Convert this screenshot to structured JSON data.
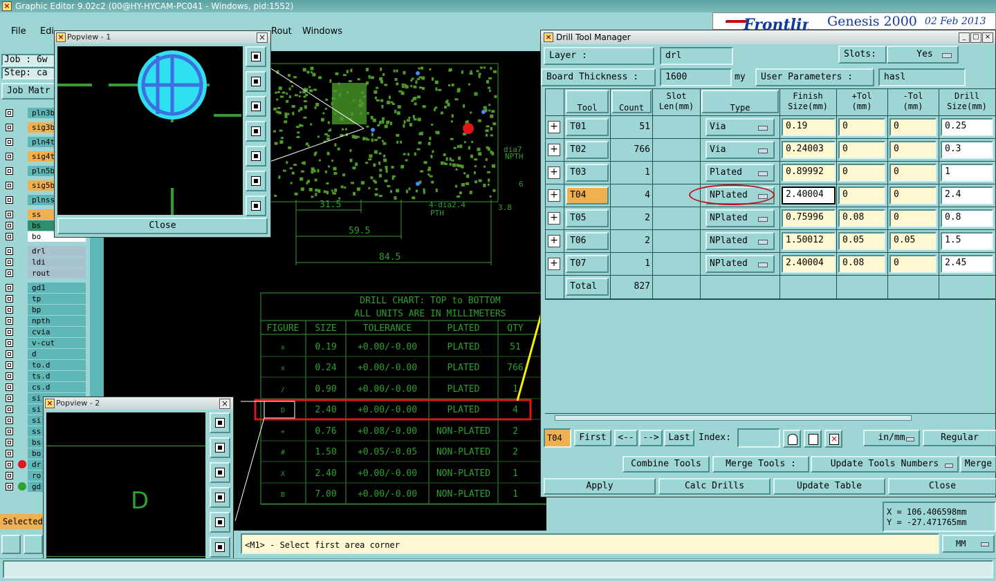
{
  "app": {
    "title": "Graphic Editor 9.02c2 (00@HY-HYCAM-PC041 - Windows, pid:1552)",
    "logo": "x-logo-icon"
  },
  "menu": {
    "items": [
      "File",
      "Edi",
      "Rout",
      "Windows"
    ]
  },
  "banner": {
    "brand": "Genesis 2000",
    "date": "02 Feb 2013"
  },
  "left": {
    "job_label": "Job : 6w",
    "step_label": "Step: ca",
    "job_matrix": "Job Matr",
    "selected_label": "Selected",
    "layers": [
      {
        "name": "pln3b",
        "style": "teal"
      },
      {
        "name": "sig3b",
        "style": "orange"
      },
      {
        "name": "pln4t",
        "style": "teal"
      },
      {
        "name": "sig4t",
        "style": "orange"
      },
      {
        "name": "pln5b",
        "style": "teal"
      },
      {
        "name": "sig5b",
        "style": "orange"
      },
      {
        "name": "plnss",
        "style": "teal"
      },
      {
        "name": "ss",
        "style": "orange"
      },
      {
        "name": "bs",
        "style": "green"
      },
      {
        "name": "bo",
        "style": "white"
      },
      {
        "name": "drl",
        "style": "grey"
      },
      {
        "name": "ldi",
        "style": "grey"
      },
      {
        "name": "rout",
        "style": "grey"
      },
      {
        "name": "gd1",
        "style": "teal"
      },
      {
        "name": "tp",
        "style": "teal"
      },
      {
        "name": "bp",
        "style": "teal"
      },
      {
        "name": "npth",
        "style": "teal"
      },
      {
        "name": "cvia",
        "style": "teal"
      },
      {
        "name": "v-cut",
        "style": "teal"
      },
      {
        "name": "d",
        "style": "teal"
      },
      {
        "name": "to.d",
        "style": "teal"
      },
      {
        "name": "ts.d",
        "style": "teal"
      },
      {
        "name": "cs.d",
        "style": "teal"
      },
      {
        "name": "si",
        "style": "teal"
      },
      {
        "name": "si",
        "style": "teal"
      },
      {
        "name": "si",
        "style": "teal"
      },
      {
        "name": "ss",
        "style": "teal"
      },
      {
        "name": "bs",
        "style": "teal"
      },
      {
        "name": "bo",
        "style": "teal"
      },
      {
        "name": "dr",
        "style": "teal"
      },
      {
        "name": "ro",
        "style": "teal"
      },
      {
        "name": "gd",
        "style": "teal"
      }
    ]
  },
  "popview1": {
    "title": "Popview - 1",
    "close": "Close"
  },
  "popview2": {
    "title": "Popview - 2",
    "glyph": "D"
  },
  "canvas": {
    "dims": {
      "d1": "31.5",
      "d2": "59.5",
      "d3": "84.5",
      "dia1": "4-dia2.4",
      "pth": "PTH",
      "dia2": "dia7",
      "npth": "NPTH",
      "d6": "6",
      "d38": "3.8"
    },
    "drill_chart": {
      "title": "DRILL CHART: TOP to BOTTOM",
      "subtitle": "ALL UNITS ARE IN MILLIMETERS",
      "headers": [
        "FIGURE",
        "SIZE",
        "TOLERANCE",
        "PLATED",
        "QTY"
      ],
      "rows": [
        {
          "fig": "x",
          "size": "0.19",
          "tol": "+0.00/-0.00",
          "plated": "PLATED",
          "qty": "51"
        },
        {
          "fig": "x",
          "size": "0.24",
          "tol": "+0.00/-0.00",
          "plated": "PLATED",
          "qty": "766"
        },
        {
          "fig": "/",
          "size": "0.90",
          "tol": "+0.00/-0.00",
          "plated": "PLATED",
          "qty": "1"
        },
        {
          "fig": "D",
          "size": "2.40",
          "tol": "+0.00/-0.00",
          "plated": "PLATED",
          "qty": "4"
        },
        {
          "fig": "+",
          "size": "0.76",
          "tol": "+0.08/-0.00",
          "plated": "NON-PLATED",
          "qty": "2"
        },
        {
          "fig": "#",
          "size": "1.50",
          "tol": "+0.05/-0.05",
          "plated": "NON-PLATED",
          "qty": "2"
        },
        {
          "fig": "X",
          "size": "2.40",
          "tol": "+0.00/-0.00",
          "plated": "NON-PLATED",
          "qty": "1"
        },
        {
          "fig": "B",
          "size": "7.00",
          "tol": "+0.00/-0.00",
          "plated": "NON-PLATED",
          "qty": "1"
        }
      ]
    }
  },
  "dtm": {
    "title": "Drill Tool Manager",
    "layer_label": "Layer      :",
    "layer_value": "drl",
    "slots_label": "Slots:",
    "slots_value": "Yes",
    "thickness_label": "Board Thickness :",
    "thickness_value": "1600",
    "thickness_unit": "my",
    "user_params_label": "User Parameters :",
    "user_params_value": "hasl",
    "headers": [
      "Tool",
      "Count",
      "Slot\nLen(mm)",
      "Type",
      "Finish\nSize(mm)",
      "+Tol\n(mm)",
      "-Tol\n(mm)",
      "Drill\nSize(mm)"
    ],
    "rows": [
      {
        "tool": "T01",
        "count": "51",
        "type": "Via",
        "finish": "0.19",
        "ptol": "0",
        "ntol": "0",
        "drill": "0.25"
      },
      {
        "tool": "T02",
        "count": "766",
        "type": "Via",
        "finish": "0.24003",
        "ptol": "0",
        "ntol": "0",
        "drill": "0.3"
      },
      {
        "tool": "T03",
        "count": "1",
        "type": "Plated",
        "finish": "0.89992",
        "ptol": "0",
        "ntol": "0",
        "drill": "1"
      },
      {
        "tool": "T04",
        "count": "4",
        "type": "NPlated",
        "finish": "2.40004",
        "ptol": "0",
        "ntol": "0",
        "drill": "2.4"
      },
      {
        "tool": "T05",
        "count": "2",
        "type": "NPlated",
        "finish": "0.75996",
        "ptol": "0.08",
        "ntol": "0",
        "drill": "0.8"
      },
      {
        "tool": "T06",
        "count": "2",
        "type": "NPlated",
        "finish": "1.50012",
        "ptol": "0.05",
        "ntol": "0.05",
        "drill": "1.5"
      },
      {
        "tool": "T07",
        "count": "1",
        "type": "NPlated",
        "finish": "2.40004",
        "ptol": "0.08",
        "ntol": "0",
        "drill": "2.45"
      }
    ],
    "total_label": "Total",
    "total_count": "827",
    "nav": {
      "current": "T04",
      "first": "First",
      "prev": "<--",
      "next": "-->",
      "last": "Last",
      "index_label": "Index:",
      "units": "in/mm",
      "mode": "Regular"
    },
    "actions": {
      "combine": "Combine Tools",
      "merge_label": "Merge Tools :",
      "update_numbers": "Update Tools Numbers",
      "merge": "Merge",
      "apply": "Apply",
      "calc": "Calc Drills",
      "update_table": "Update Table",
      "close": "Close"
    }
  },
  "status": {
    "prompt": "<M1> - Select first area corner",
    "unit": "MM",
    "x": "X = 106.406598mm",
    "y": "Y = -27.471765mm"
  },
  "colors": {
    "highlight_red": "#e0151b",
    "arrow_yellow": "#f4f400",
    "cad_green": "#2fa02f",
    "teal_bg": "#9ed6d6"
  }
}
